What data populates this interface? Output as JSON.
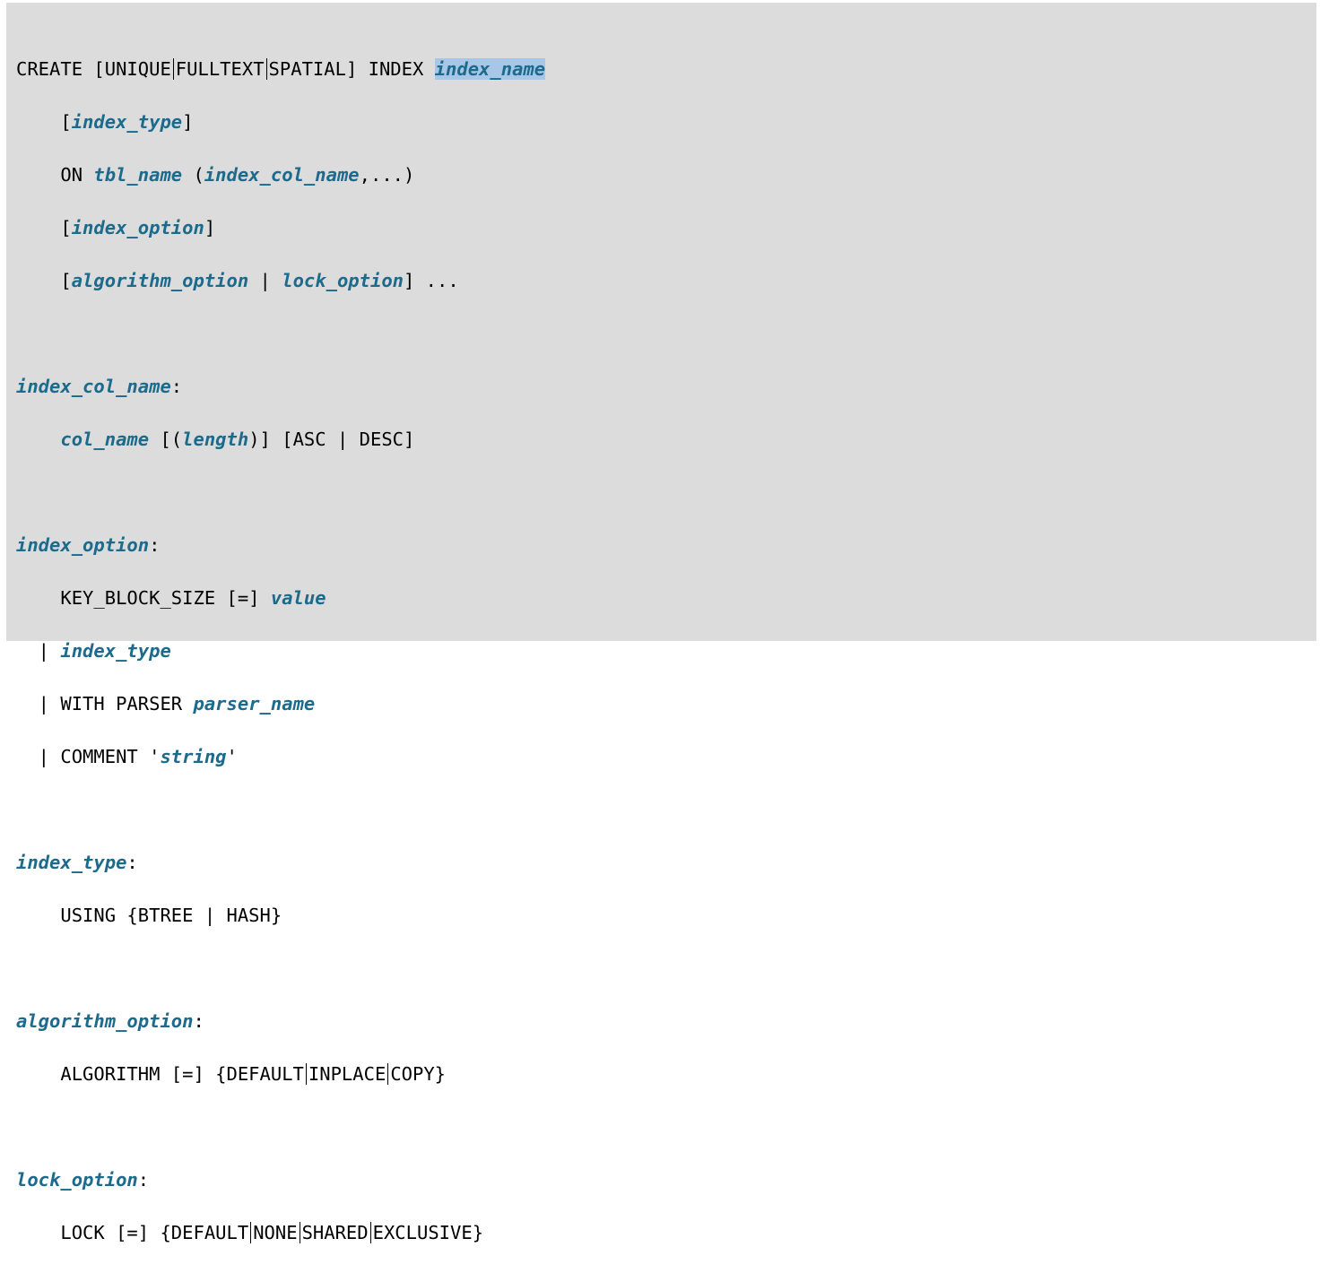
{
  "syntax": {
    "create_index": {
      "l1_create": "CREATE [UNIQUE",
      "l1_fulltext": "FULLTEXT",
      "l1_spatial": "SPATIAL] INDEX ",
      "l1_index_name": "index_name",
      "l2_open": "    [",
      "l2_index_type": "index_type",
      "l2_close": "]",
      "l3_on": "    ON ",
      "l3_tbl_name": "tbl_name",
      "l3_paren_open": " (",
      "l3_index_col_name": "index_col_name",
      "l3_rest": ",...)",
      "l4_open": "    [",
      "l4_index_option": "index_option",
      "l4_close": "]",
      "l5_open": "    [",
      "l5_algorithm_option": "algorithm_option",
      "l5_sep": " | ",
      "l5_lock_option": "lock_option",
      "l5_close": "] ..."
    },
    "index_col_name": {
      "name": "index_col_name",
      "colon": ":",
      "l1_indent": "    ",
      "l1_col_name": "col_name",
      "l1_open": " [(",
      "l1_length": "length",
      "l1_mid": ")] [ASC | DESC]"
    },
    "index_option": {
      "name": "index_option",
      "colon": ":",
      "l1_kbs": "    KEY_BLOCK_SIZE [=] ",
      "l1_value": "value",
      "l2_bar": "  | ",
      "l2_index_type": "index_type",
      "l3_bar": "  | ",
      "l3_with_parser": "WITH PARSER ",
      "l3_parser_name": "parser_name",
      "l4_bar": "  | ",
      "l4_comment": "COMMENT '",
      "l4_string": "string",
      "l4_quote": "'"
    },
    "index_type": {
      "name": "index_type",
      "colon": ":",
      "l1": "    USING {BTREE | HASH}"
    },
    "algorithm_option": {
      "name": "algorithm_option",
      "colon": ":",
      "l1_a": "    ALGORITHM [=] {DEFAULT",
      "l1_b": "INPLACE",
      "l1_c": "COPY}"
    },
    "lock_option": {
      "name": "lock_option",
      "colon": ":",
      "l1_a": "    LOCK [=] {DEFAULT",
      "l1_b": "NONE",
      "l1_c": "SHARED",
      "l1_d": "EXCLUSIVE}"
    }
  },
  "colors": {
    "background": "#dcdcdc",
    "variable": "#1c6a8c",
    "selection": "#a8c7e6"
  }
}
